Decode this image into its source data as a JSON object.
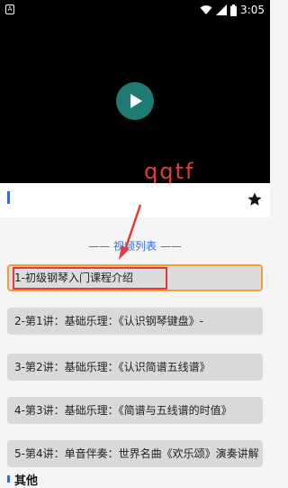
{
  "status_bar": {
    "notification_icon": "A",
    "time": "3:05",
    "icons": [
      "wifi-icon",
      "signal-icon",
      "battery-icon"
    ]
  },
  "video": {
    "play_icon": "play-icon",
    "accent": "#1f7a74"
  },
  "info": {
    "favorite_icon": "star-icon"
  },
  "annotation": {
    "watermark": "qqtf",
    "color": "#e23b3b"
  },
  "list": {
    "header": "—— 视频列表 ——",
    "items": [
      "1-初级钢琴入门课程介绍",
      "2-第1讲：基础乐理：《认识钢琴键盘》-",
      "3-第2讲：基础乐理：《认识简谱五线谱》",
      "4-第3讲：基础乐理：《简谱与五线谱的时值》",
      "5-第4讲：单音伴奏：世界名曲《欢乐颂》演奏讲解"
    ],
    "active_color": "#f0a032"
  },
  "next_section": {
    "title": "其他"
  }
}
